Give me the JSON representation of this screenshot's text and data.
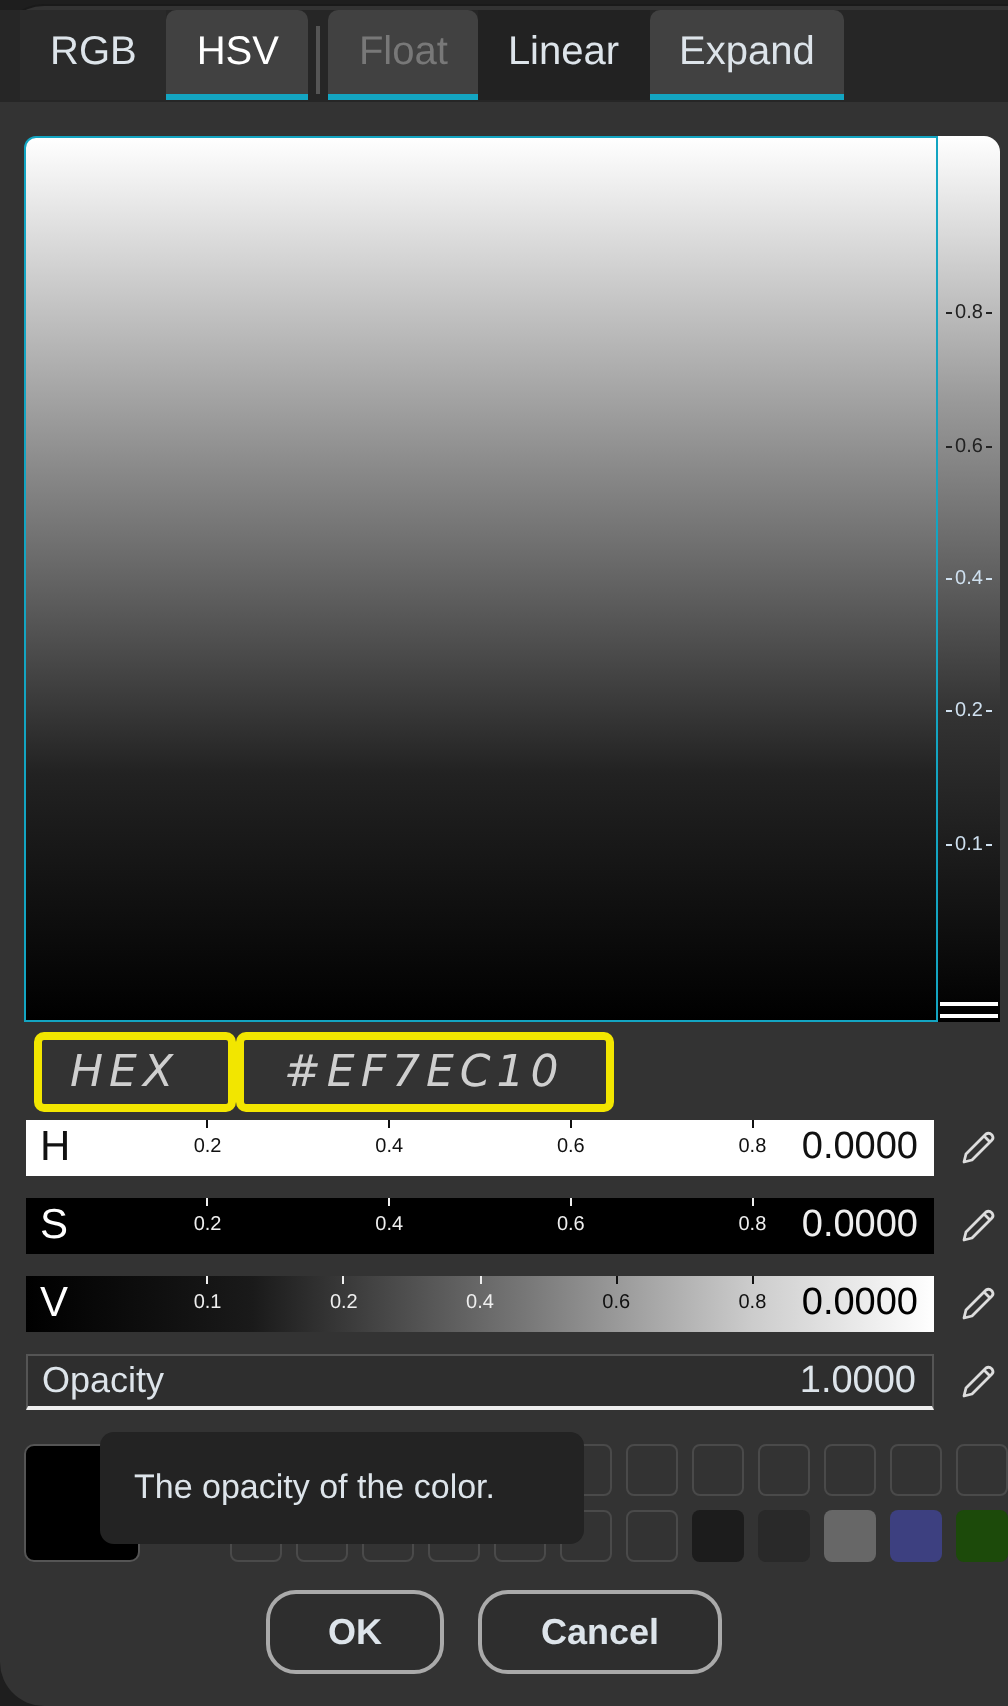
{
  "tabs": [
    {
      "label": "RGB",
      "kind": "mode",
      "selected": false
    },
    {
      "label": "HSV",
      "kind": "mode",
      "selected": true
    },
    {
      "label": "Float",
      "kind": "toggle",
      "on": true,
      "disabled": true
    },
    {
      "label": "Linear",
      "kind": "toggle",
      "on": false,
      "disabled": false
    },
    {
      "label": "Expand",
      "kind": "toggle",
      "on": true,
      "disabled": false
    }
  ],
  "value_strip": {
    "ticks": [
      "0.8",
      "0.6",
      "0.4",
      "0.2",
      "0.1"
    ]
  },
  "annotations": [
    "HEX",
    "#EF7EC10"
  ],
  "sliders": [
    {
      "label": "H",
      "kind": "hue",
      "ticks": [
        "0.2",
        "0.4",
        "0.6",
        "0.8"
      ],
      "value": "0.0000"
    },
    {
      "label": "S",
      "kind": "saturation",
      "ticks": [
        "0.2",
        "0.4",
        "0.6",
        "0.8"
      ],
      "value": "0.0000"
    },
    {
      "label": "V",
      "kind": "value",
      "ticks": [
        "0.1",
        "0.2",
        "0.4",
        "0.6",
        "0.8"
      ],
      "value": "0.0000"
    },
    {
      "label": "Opacity",
      "kind": "field",
      "value": "1.0000"
    }
  ],
  "current_color": {
    "color": "#000000"
  },
  "swatch_rows": [
    [
      {
        "kind": "empty"
      },
      {
        "kind": "empty"
      },
      {
        "kind": "empty"
      },
      {
        "kind": "empty"
      },
      {
        "kind": "empty"
      },
      {
        "kind": "empty"
      },
      {
        "kind": "empty"
      }
    ],
    [
      {
        "kind": "empty"
      },
      {
        "kind": "empty"
      },
      {
        "kind": "empty"
      },
      {
        "kind": "empty"
      },
      {
        "kind": "empty"
      },
      {
        "kind": "empty"
      },
      {
        "kind": "empty"
      },
      {
        "kind": "filled",
        "color": "#1c1c1c"
      },
      {
        "kind": "filled",
        "color": "#292929"
      },
      {
        "kind": "filled",
        "color": "#676767"
      },
      {
        "kind": "filled",
        "color": "#3d4080"
      },
      {
        "kind": "filled",
        "color": "#1c4a0a"
      }
    ]
  ],
  "tooltip": "The opacity of the color.",
  "buttons": [
    "OK",
    "Cancel"
  ]
}
